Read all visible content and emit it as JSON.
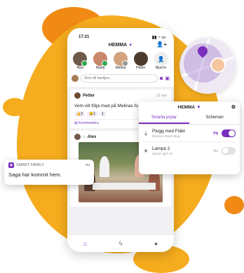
{
  "phone": {
    "time": "17:21",
    "home_title": "HEMMA",
    "members": [
      {
        "name": "Alex",
        "color": "#6f5a4a"
      },
      {
        "name": "Maria",
        "color": "#c9876b"
      },
      {
        "name": "Melina",
        "color": "#d2a37e"
      },
      {
        "name": "Petter",
        "color": "#4e3b2f"
      },
      {
        "name": "Bjud in",
        "color": "#eeeeee"
      }
    ],
    "post_placeholder": "Skriv till familjen...",
    "post_card": {
      "author": "Petter",
      "time": "22 min",
      "text": "Vem vill följa med på Melinas fo... helgen?",
      "reaction_1": "👍2",
      "reaction_2": "😮1",
      "reaction_3": "1",
      "comment_label": "Kommentera"
    },
    "second_card": {
      "author": "Alex"
    },
    "nav": [
      "home",
      "flash",
      "profile"
    ]
  },
  "notification": {
    "app": "SMART FAMILY",
    "when": "nu",
    "message": "Saga har kommit hem."
  },
  "panel": {
    "title": "HEMMA",
    "tabs": [
      "Smarta prylar",
      "Scheman"
    ],
    "devices": [
      {
        "name": "Plugg med Fläkt",
        "sub": "Develco Smart plug",
        "state": "På",
        "on": true
      },
      {
        "name": "Lampa 2",
        "sub": "Opram ajz7 vit",
        "state": "Av",
        "on": false
      }
    ]
  },
  "colors": {
    "accent": "#7b2fbe",
    "background_blob": "#f5ac1e"
  }
}
